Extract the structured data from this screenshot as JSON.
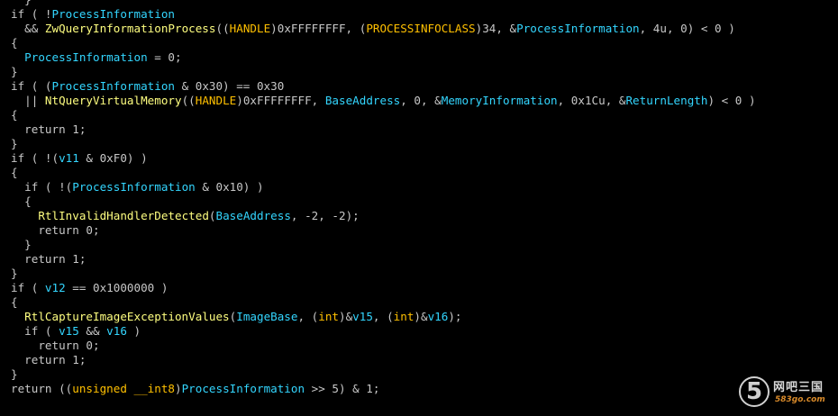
{
  "code_lines": [
    [
      {
        "t": "  }",
        "c": "plain"
      }
    ],
    [
      {
        "t": "if ( ",
        "c": "plain"
      },
      {
        "t": "!",
        "c": "plain"
      },
      {
        "t": "ProcessInformation",
        "c": "var"
      }
    ],
    [
      {
        "t": "  && ",
        "c": "plain"
      },
      {
        "t": "ZwQueryInformationProcess",
        "c": "func"
      },
      {
        "t": "((",
        "c": "plain"
      },
      {
        "t": "HANDLE",
        "c": "type"
      },
      {
        "t": ")0xFFFFFFFF, (",
        "c": "plain"
      },
      {
        "t": "PROCESSINFOCLASS",
        "c": "type"
      },
      {
        "t": ")34, &",
        "c": "plain"
      },
      {
        "t": "ProcessInformation",
        "c": "var"
      },
      {
        "t": ", 4u, 0) < 0 )",
        "c": "plain"
      }
    ],
    [
      {
        "t": "{",
        "c": "plain"
      }
    ],
    [
      {
        "t": "  ",
        "c": "plain"
      },
      {
        "t": "ProcessInformation",
        "c": "var"
      },
      {
        "t": " = 0;",
        "c": "plain"
      }
    ],
    [
      {
        "t": "}",
        "c": "plain"
      }
    ],
    [
      {
        "t": "if ( (",
        "c": "plain"
      },
      {
        "t": "ProcessInformation",
        "c": "var"
      },
      {
        "t": " & 0x30) == 0x30",
        "c": "plain"
      }
    ],
    [
      {
        "t": "  || ",
        "c": "plain"
      },
      {
        "t": "NtQueryVirtualMemory",
        "c": "func"
      },
      {
        "t": "((",
        "c": "plain"
      },
      {
        "t": "HANDLE",
        "c": "type"
      },
      {
        "t": ")0xFFFFFFFF, ",
        "c": "plain"
      },
      {
        "t": "BaseAddress",
        "c": "var"
      },
      {
        "t": ", 0, &",
        "c": "plain"
      },
      {
        "t": "MemoryInformation",
        "c": "var"
      },
      {
        "t": ", 0x1Cu, &",
        "c": "plain"
      },
      {
        "t": "ReturnLength",
        "c": "var"
      },
      {
        "t": ") < 0 )",
        "c": "plain"
      }
    ],
    [
      {
        "t": "{",
        "c": "plain"
      }
    ],
    [
      {
        "t": "  return 1;",
        "c": "plain"
      }
    ],
    [
      {
        "t": "}",
        "c": "plain"
      }
    ],
    [
      {
        "t": "if ( !(",
        "c": "plain"
      },
      {
        "t": "v11",
        "c": "var"
      },
      {
        "t": " & 0xF0) )",
        "c": "plain"
      }
    ],
    [
      {
        "t": "{",
        "c": "plain"
      }
    ],
    [
      {
        "t": "  if ( !(",
        "c": "plain"
      },
      {
        "t": "ProcessInformation",
        "c": "var"
      },
      {
        "t": " & 0x10) )",
        "c": "plain"
      }
    ],
    [
      {
        "t": "  {",
        "c": "plain"
      }
    ],
    [
      {
        "t": "    ",
        "c": "plain"
      },
      {
        "t": "RtlInvalidHandlerDetected",
        "c": "func"
      },
      {
        "t": "(",
        "c": "plain"
      },
      {
        "t": "BaseAddress",
        "c": "var"
      },
      {
        "t": ", -2, -2);",
        "c": "plain"
      }
    ],
    [
      {
        "t": "    return 0;",
        "c": "plain"
      }
    ],
    [
      {
        "t": "  }",
        "c": "plain"
      }
    ],
    [
      {
        "t": "  return 1;",
        "c": "plain"
      }
    ],
    [
      {
        "t": "}",
        "c": "plain"
      }
    ],
    [
      {
        "t": "if ( ",
        "c": "plain"
      },
      {
        "t": "v12",
        "c": "var"
      },
      {
        "t": " == 0x1000000 )",
        "c": "plain"
      }
    ],
    [
      {
        "t": "{",
        "c": "plain"
      }
    ],
    [
      {
        "t": "  ",
        "c": "plain"
      },
      {
        "t": "RtlCaptureImageExceptionValues",
        "c": "func"
      },
      {
        "t": "(",
        "c": "plain"
      },
      {
        "t": "ImageBase",
        "c": "var"
      },
      {
        "t": ", (",
        "c": "plain"
      },
      {
        "t": "int",
        "c": "type"
      },
      {
        "t": ")&",
        "c": "plain"
      },
      {
        "t": "v15",
        "c": "var"
      },
      {
        "t": ", (",
        "c": "plain"
      },
      {
        "t": "int",
        "c": "type"
      },
      {
        "t": ")&",
        "c": "plain"
      },
      {
        "t": "v16",
        "c": "var"
      },
      {
        "t": ");",
        "c": "plain"
      }
    ],
    [
      {
        "t": "  if ( ",
        "c": "plain"
      },
      {
        "t": "v15",
        "c": "var"
      },
      {
        "t": " && ",
        "c": "plain"
      },
      {
        "t": "v16",
        "c": "var"
      },
      {
        "t": " )",
        "c": "plain"
      }
    ],
    [
      {
        "t": "    return 0;",
        "c": "plain"
      }
    ],
    [
      {
        "t": "  return 1;",
        "c": "plain"
      }
    ],
    [
      {
        "t": "}",
        "c": "plain"
      }
    ],
    [
      {
        "t": "return ((",
        "c": "plain"
      },
      {
        "t": "unsigned __int8",
        "c": "type"
      },
      {
        "t": ")",
        "c": "plain"
      },
      {
        "t": "ProcessInformation",
        "c": "var"
      },
      {
        "t": " >> 5) & 1;",
        "c": "plain"
      }
    ]
  ],
  "watermark": {
    "logo_text": "5",
    "name": "网吧三国",
    "url": "583go.com"
  }
}
